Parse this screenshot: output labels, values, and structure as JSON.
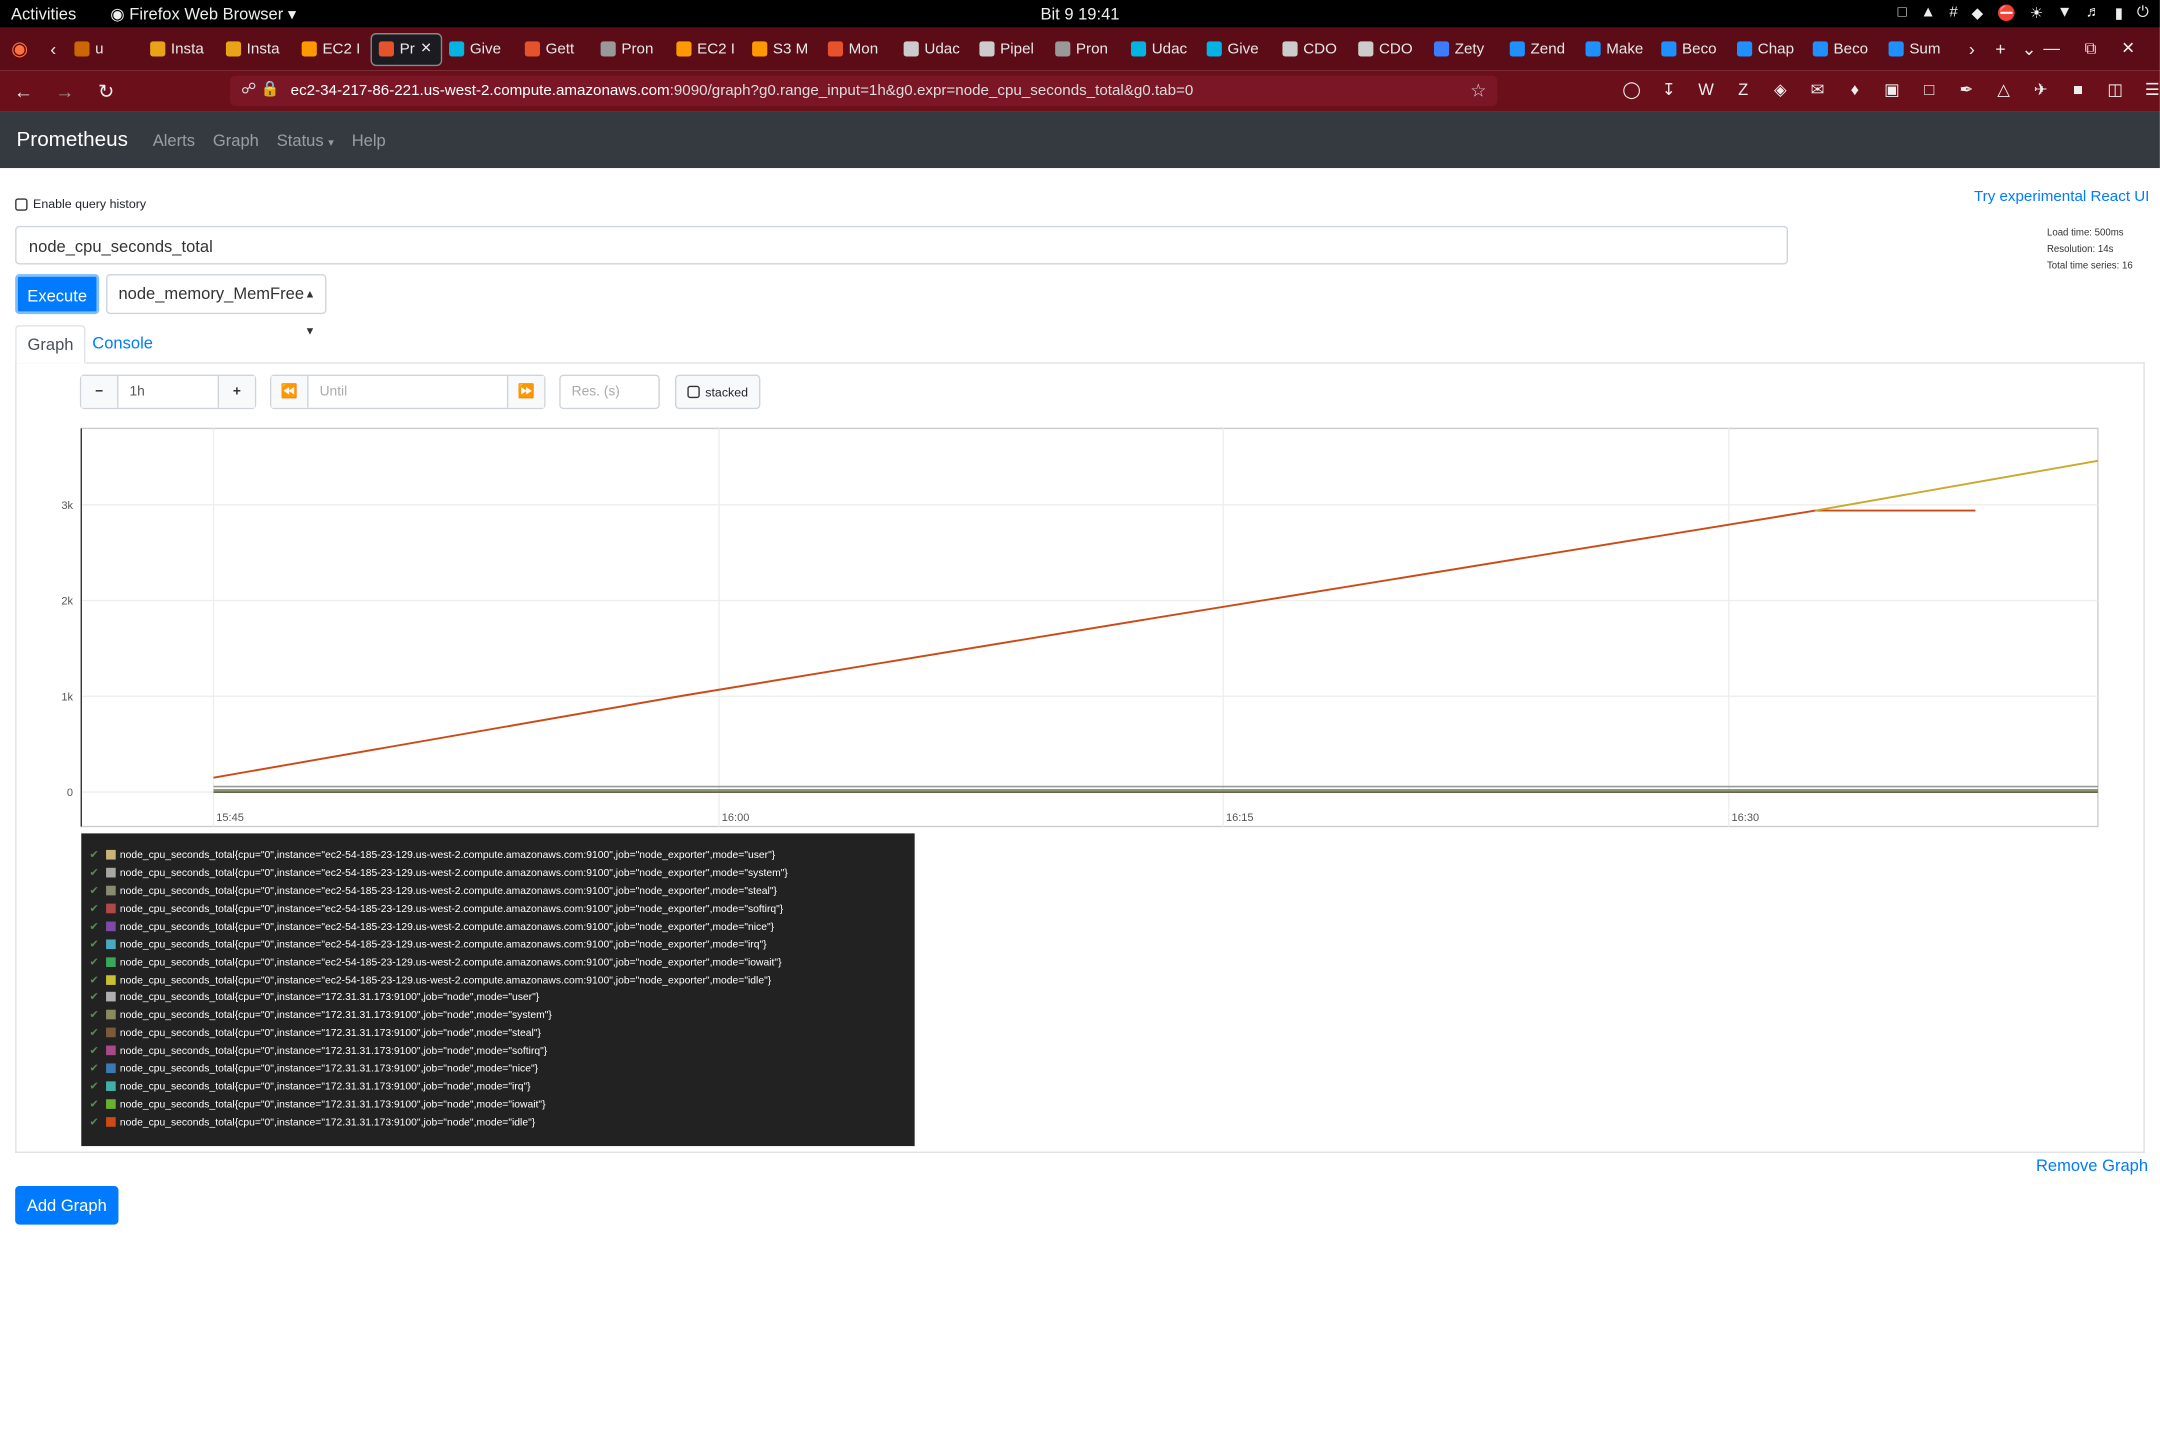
{
  "system": {
    "activities": "Activities",
    "app": "Firefox Web Browser",
    "clock": "Bit 9  19:41"
  },
  "browser": {
    "tabs": [
      {
        "label": "u",
        "color": "#cc6600"
      },
      {
        "label": "Insta",
        "color": "#e8a317"
      },
      {
        "label": "Insta",
        "color": "#e8a317"
      },
      {
        "label": "EC2 I",
        "color": "#ff9900"
      },
      {
        "label": "Pr",
        "color": "#e6522c",
        "active": true
      },
      {
        "label": "Give",
        "color": "#02b3e4"
      },
      {
        "label": "Gett",
        "color": "#e6522c"
      },
      {
        "label": "Pron",
        "color": "#999999"
      },
      {
        "label": "EC2 I",
        "color": "#ff9900"
      },
      {
        "label": "S3 M",
        "color": "#ff9900"
      },
      {
        "label": "Mon",
        "color": "#e6522c"
      },
      {
        "label": "Udac",
        "color": "#cccccc"
      },
      {
        "label": "Pipel",
        "color": "#cccccc"
      },
      {
        "label": "Pron",
        "color": "#999999"
      },
      {
        "label": "Udac",
        "color": "#02b3e4"
      },
      {
        "label": "Give",
        "color": "#02b3e4"
      },
      {
        "label": "CDO",
        "color": "#cccccc"
      },
      {
        "label": "CDO",
        "color": "#cccccc"
      },
      {
        "label": "Zety",
        "color": "#3d7cff"
      },
      {
        "label": "Zend",
        "color": "#1e90ff"
      },
      {
        "label": "Make",
        "color": "#1e90ff"
      },
      {
        "label": "Beco",
        "color": "#1e90ff"
      },
      {
        "label": "Chap",
        "color": "#1e90ff"
      },
      {
        "label": "Beco",
        "color": "#1e90ff"
      },
      {
        "label": "Sum",
        "color": "#1e90ff"
      }
    ],
    "url_host": "ec2-34-217-86-221.us-west-2.compute.amazonaws.com",
    "url_rest": ":9090/graph?g0.range_input=1h&g0.expr=node_cpu_seconds_total&g0.tab=0"
  },
  "nav": {
    "brand": "Prometheus",
    "links": [
      "Alerts",
      "Graph",
      "Status",
      "Help"
    ]
  },
  "page": {
    "query_history": "Enable query history",
    "react_link": "Try experimental React UI",
    "expression": "node_cpu_seconds_total",
    "load_time": "Load time: 500ms",
    "resolution": "Resolution: 14s",
    "total_series": "Total time series: 16",
    "execute": "Execute",
    "metric_select": "node_memory_MemFree",
    "tab_graph": "Graph",
    "tab_console": "Console",
    "range": "1h",
    "until_placeholder": "Until",
    "res_placeholder": "Res. (s)",
    "stacked": "stacked",
    "remove_graph": "Remove Graph",
    "add_graph": "Add Graph"
  },
  "chart_data": {
    "type": "line",
    "x_ticks": [
      "15:45",
      "16:00",
      "16:15",
      "16:30"
    ],
    "y_ticks": [
      "0",
      "1k",
      "2k",
      "3k"
    ],
    "series": [
      {
        "name": "node_cpu_seconds_total{cpu=\"0\",instance=\"172.31.31.173:9100\",job=\"node\",mode=\"idle\"}",
        "color": "#cb4b16",
        "points": [
          [
            0,
            150
          ],
          [
            0.25,
            1010
          ],
          [
            0.5,
            1820
          ],
          [
            0.85,
            2940
          ],
          [
            1.0,
            2940
          ]
        ]
      },
      {
        "name": "node_cpu_seconds_total{cpu=\"0\",instance=\"ec2-54-185-23-129.us-west-2.compute.amazonaws.com:9100\",job=\"node_exporter\",mode=\"idle\"}",
        "color": "#c9a92e",
        "points": [
          [
            0.85,
            2940
          ],
          [
            1.0,
            3460
          ]
        ]
      }
    ],
    "baseline_colors": [
      "#999999",
      "#7a8b5b",
      "#5d4a3a"
    ]
  },
  "legend": [
    {
      "label": "node_cpu_seconds_total{cpu=\"0\",instance=\"ec2-54-185-23-129.us-west-2.compute.amazonaws.com:9100\",job=\"node_exporter\",mode=\"user\"}",
      "color": "#c9b37a"
    },
    {
      "label": "node_cpu_seconds_total{cpu=\"0\",instance=\"ec2-54-185-23-129.us-west-2.compute.amazonaws.com:9100\",job=\"node_exporter\",mode=\"system\"}",
      "color": "#a8a8a0"
    },
    {
      "label": "node_cpu_seconds_total{cpu=\"0\",instance=\"ec2-54-185-23-129.us-west-2.compute.amazonaws.com:9100\",job=\"node_exporter\",mode=\"steal\"}",
      "color": "#8a8a70"
    },
    {
      "label": "node_cpu_seconds_total{cpu=\"0\",instance=\"ec2-54-185-23-129.us-west-2.compute.amazonaws.com:9100\",job=\"node_exporter\",mode=\"softirq\"}",
      "color": "#b04848"
    },
    {
      "label": "node_cpu_seconds_total{cpu=\"0\",instance=\"ec2-54-185-23-129.us-west-2.compute.amazonaws.com:9100\",job=\"node_exporter\",mode=\"nice\"}",
      "color": "#7d4aa8"
    },
    {
      "label": "node_cpu_seconds_total{cpu=\"0\",instance=\"ec2-54-185-23-129.us-west-2.compute.amazonaws.com:9100\",job=\"node_exporter\",mode=\"irq\"}",
      "color": "#4aa8c0"
    },
    {
      "label": "node_cpu_seconds_total{cpu=\"0\",instance=\"ec2-54-185-23-129.us-west-2.compute.amazonaws.com:9100\",job=\"node_exporter\",mode=\"iowait\"}",
      "color": "#3aa85a"
    },
    {
      "label": "node_cpu_seconds_total{cpu=\"0\",instance=\"ec2-54-185-23-129.us-west-2.compute.amazonaws.com:9100\",job=\"node_exporter\",mode=\"idle\"}",
      "color": "#c9c030"
    },
    {
      "label": "node_cpu_seconds_total{cpu=\"0\",instance=\"172.31.31.173:9100\",job=\"node\",mode=\"user\"}",
      "color": "#b0b0b0"
    },
    {
      "label": "node_cpu_seconds_total{cpu=\"0\",instance=\"172.31.31.173:9100\",job=\"node\",mode=\"system\"}",
      "color": "#8a8a60"
    },
    {
      "label": "node_cpu_seconds_total{cpu=\"0\",instance=\"172.31.31.173:9100\",job=\"node\",mode=\"steal\"}",
      "color": "#7a5a3a"
    },
    {
      "label": "node_cpu_seconds_total{cpu=\"0\",instance=\"172.31.31.173:9100\",job=\"node\",mode=\"softirq\"}",
      "color": "#a84a8a"
    },
    {
      "label": "node_cpu_seconds_total{cpu=\"0\",instance=\"172.31.31.173:9100\",job=\"node\",mode=\"nice\"}",
      "color": "#3a7ab0"
    },
    {
      "label": "node_cpu_seconds_total{cpu=\"0\",instance=\"172.31.31.173:9100\",job=\"node\",mode=\"irq\"}",
      "color": "#40b0a8"
    },
    {
      "label": "node_cpu_seconds_total{cpu=\"0\",instance=\"172.31.31.173:9100\",job=\"node\",mode=\"iowait\"}",
      "color": "#6ab030"
    },
    {
      "label": "node_cpu_seconds_total{cpu=\"0\",instance=\"172.31.31.173:9100\",job=\"node\",mode=\"idle\"}",
      "color": "#cb4b16"
    }
  ]
}
